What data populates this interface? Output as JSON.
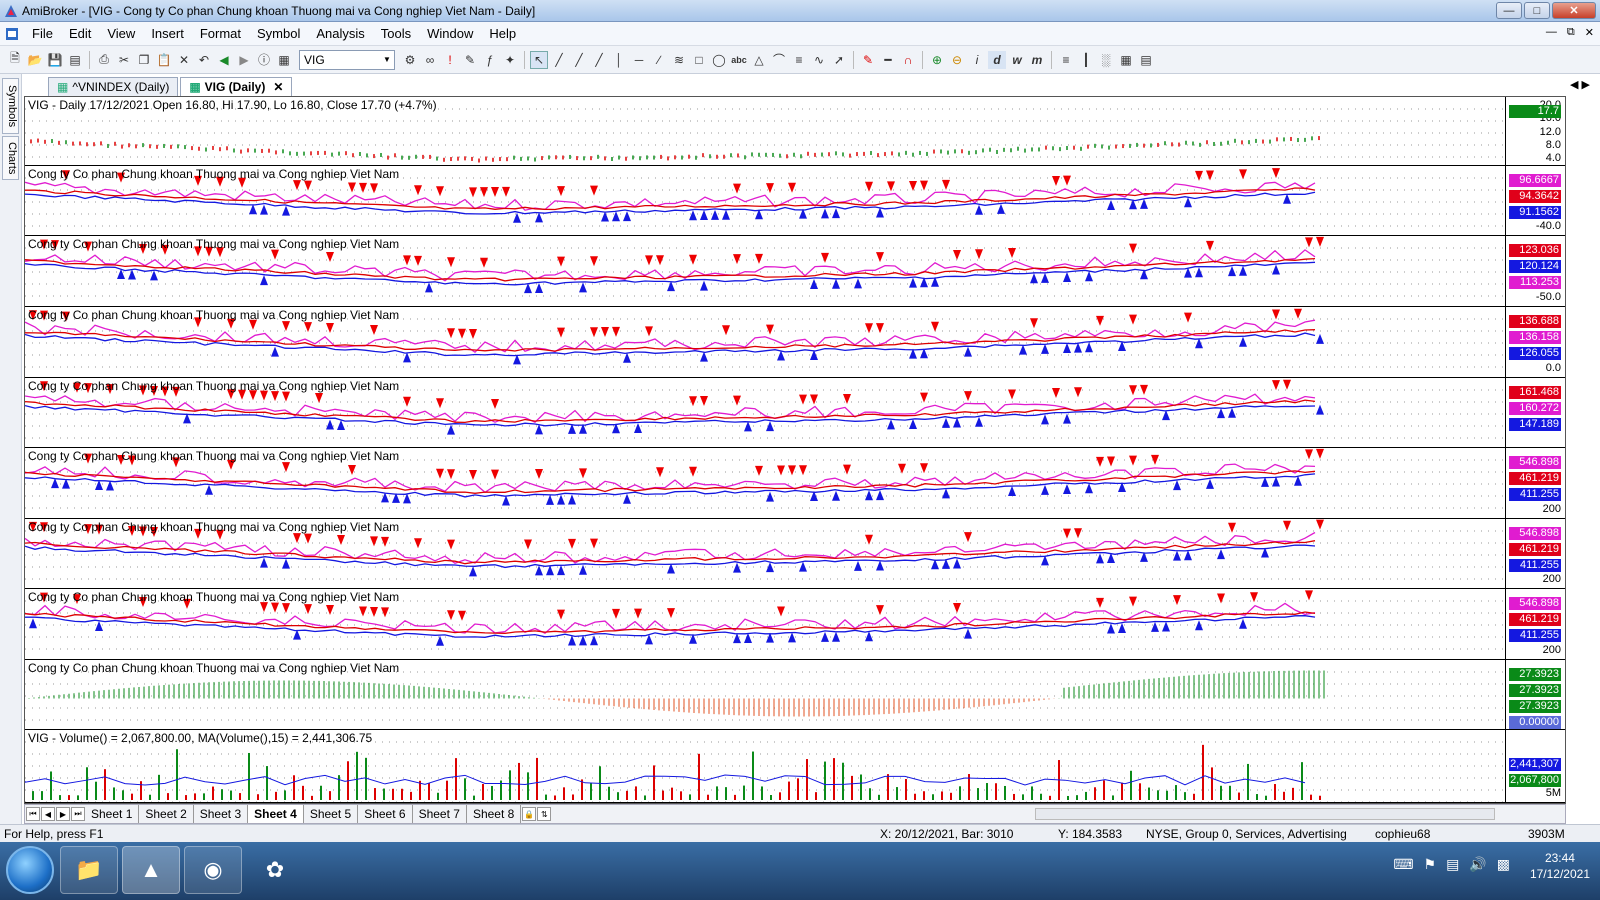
{
  "window": {
    "title": "AmiBroker - [VIG - Cong ty Co phan Chung khoan Thuong mai va Cong nghiep Viet Nam - Daily]"
  },
  "menu": [
    "File",
    "Edit",
    "View",
    "Insert",
    "Format",
    "Symbol",
    "Analysis",
    "Tools",
    "Window",
    "Help"
  ],
  "toolbar": {
    "symbol": "VIG"
  },
  "side_tabs": [
    "Symbols",
    "Charts"
  ],
  "doc_tabs": [
    {
      "label": "^VNINDEX (Daily)",
      "active": false
    },
    {
      "label": "VIG (Daily)",
      "active": true
    }
  ],
  "panes": [
    {
      "label": "VIG - Daily 17/12/2021 Open 16.80, Hi 17.90, Lo 16.80, Close 17.70 (+4.7%)",
      "ticks": [
        "20.0",
        "16.0",
        "12.0",
        "8.0",
        "4.0"
      ],
      "badges": [
        {
          "text": "17.7",
          "color": "#0a8a18"
        }
      ]
    },
    {
      "label": "Cong ty Co phan Chung khoan Thuong mai va Cong nghiep Viet Nam",
      "ticks": [
        "-40.0"
      ],
      "badges": [
        {
          "text": "96.6667",
          "color": "#e01cd0"
        },
        {
          "text": "94.3642",
          "color": "#e0001a"
        },
        {
          "text": "91.1562",
          "color": "#1418e0"
        }
      ]
    },
    {
      "label": "Cong ty Co phan Chung khoan Thuong mai va Cong nghiep Viet Nam",
      "ticks": [
        "-50.0"
      ],
      "badges": [
        {
          "text": "123.036",
          "color": "#e0001a"
        },
        {
          "text": "120.124",
          "color": "#1418e0"
        },
        {
          "text": "113.253",
          "color": "#e01cd0"
        }
      ]
    },
    {
      "label": "Cong ty Co phan Chung khoan Thuong mai va Cong nghiep Viet Nam",
      "ticks": [
        "0.0"
      ],
      "badges": [
        {
          "text": "136.688",
          "color": "#e0001a"
        },
        {
          "text": "136.158",
          "color": "#e01cd0"
        },
        {
          "text": "126.055",
          "color": "#1418e0"
        }
      ]
    },
    {
      "label": "Cong ty Co phan Chung khoan Thuong mai va Cong nghiep Viet Nam",
      "ticks": [],
      "badges": [
        {
          "text": "161.468",
          "color": "#e0001a"
        },
        {
          "text": "160.272",
          "color": "#e01cd0"
        },
        {
          "text": "147.189",
          "color": "#1418e0"
        }
      ]
    },
    {
      "label": "Cong ty Co phan Chung khoan Thuong mai va Cong nghiep Viet Nam",
      "ticks": [
        "200"
      ],
      "badges": [
        {
          "text": "546.898",
          "color": "#e01cd0"
        },
        {
          "text": "461.219",
          "color": "#e0001a"
        },
        {
          "text": "411.255",
          "color": "#1418e0"
        }
      ]
    },
    {
      "label": "Cong ty Co phan Chung khoan Thuong mai va Cong nghiep Viet Nam",
      "ticks": [
        "200"
      ],
      "badges": [
        {
          "text": "546.898",
          "color": "#e01cd0"
        },
        {
          "text": "461.219",
          "color": "#e0001a"
        },
        {
          "text": "411.255",
          "color": "#1418e0"
        }
      ]
    },
    {
      "label": "Cong ty Co phan Chung khoan Thuong mai va Cong nghiep Viet Nam",
      "ticks": [
        "200"
      ],
      "badges": [
        {
          "text": "546.898",
          "color": "#e01cd0"
        },
        {
          "text": "461.219",
          "color": "#e0001a"
        },
        {
          "text": "411.255",
          "color": "#1418e0"
        }
      ]
    },
    {
      "label": "Cong ty Co phan Chung khoan Thuong mai va Cong nghiep Viet Nam",
      "ticks": [],
      "badges": [
        {
          "text": "27.3923",
          "color": "#0a8a18"
        },
        {
          "text": "27.3923",
          "color": "#0a8a18"
        },
        {
          "text": "27.3923",
          "color": "#0a8a18"
        },
        {
          "text": "0.00000",
          "color": "#5a6ad8"
        }
      ]
    },
    {
      "label": "VIG - Volume() = 2,067,800.00, MA(Volume(),15) = 2,441,306.75",
      "ticks": [
        "5M"
      ],
      "badges": [
        {
          "text": "2,441,307",
          "color": "#1418e0"
        },
        {
          "text": "2,067,800",
          "color": "#0a8a18"
        }
      ]
    }
  ],
  "sheets": [
    "Sheet 1",
    "Sheet 2",
    "Sheet 3",
    "Sheet 4",
    "Sheet 5",
    "Sheet 6",
    "Sheet 7",
    "Sheet 8"
  ],
  "active_sheet": "Sheet 4",
  "status": {
    "help": "For Help, press F1",
    "position": "X: 20/12/2021, Bar: 3010",
    "y": "Y: 184.3583",
    "info": "NYSE, Group 0, Services, Advertising",
    "user": "cophieu68",
    "memory": "3903M"
  },
  "clock": {
    "time": "23:44",
    "date": "17/12/2021"
  }
}
